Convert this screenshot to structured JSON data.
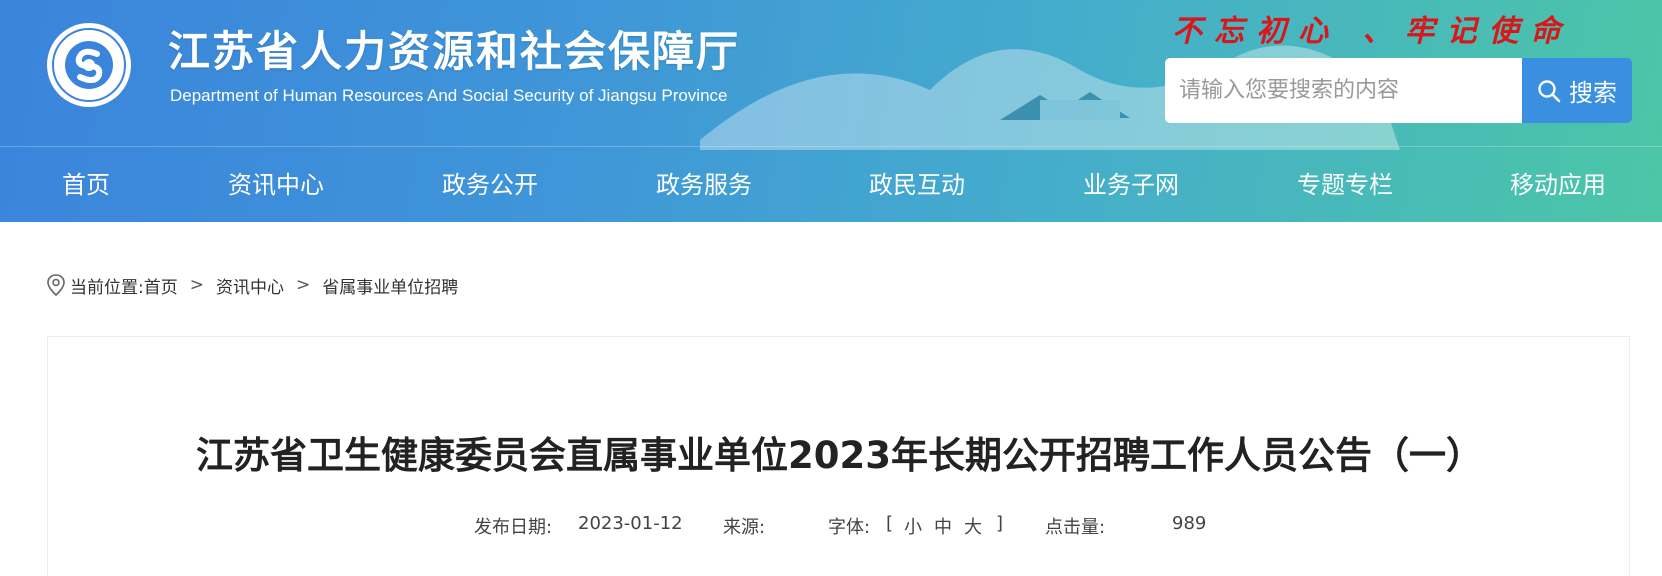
{
  "header": {
    "title_cn": "江苏省人力资源和社会保障厅",
    "title_en": "Department of Human Resources And Social Security of Jiangsu Province",
    "slogan": "不忘初心  、牢记使命",
    "logo_icon": "hrss-logo-icon",
    "colors": {
      "gradient_start": "#3b84dc",
      "gradient_end": "#4cc6a6",
      "slogan": "#d9161a"
    }
  },
  "search": {
    "placeholder": "请输入您要搜索的内容",
    "button_label": "搜索",
    "icon": "search-icon"
  },
  "nav": {
    "items": [
      "首页",
      "资讯中心",
      "政务公开",
      "政务服务",
      "政民互动",
      "业务子网",
      "专题专栏",
      "移动应用"
    ]
  },
  "breadcrumb": {
    "prefix": "当前位置:",
    "items": [
      "首页",
      "资讯中心",
      "省属事业单位招聘"
    ],
    "separator": ">",
    "icon": "location-pin-icon"
  },
  "article": {
    "title": "江苏省卫生健康委员会直属事业单位2023年长期公开招聘工作人员公告（一）",
    "date_label": "发布日期:",
    "date_value": "2023-01-12",
    "source_label": "来源:",
    "source_value": "",
    "font_label": "字体:",
    "font_bracket_open": "[",
    "font_small": "小",
    "font_medium": "中",
    "font_large": "大",
    "font_bracket_close": "]",
    "clicks_label": "点击量:",
    "clicks_value": "989"
  }
}
